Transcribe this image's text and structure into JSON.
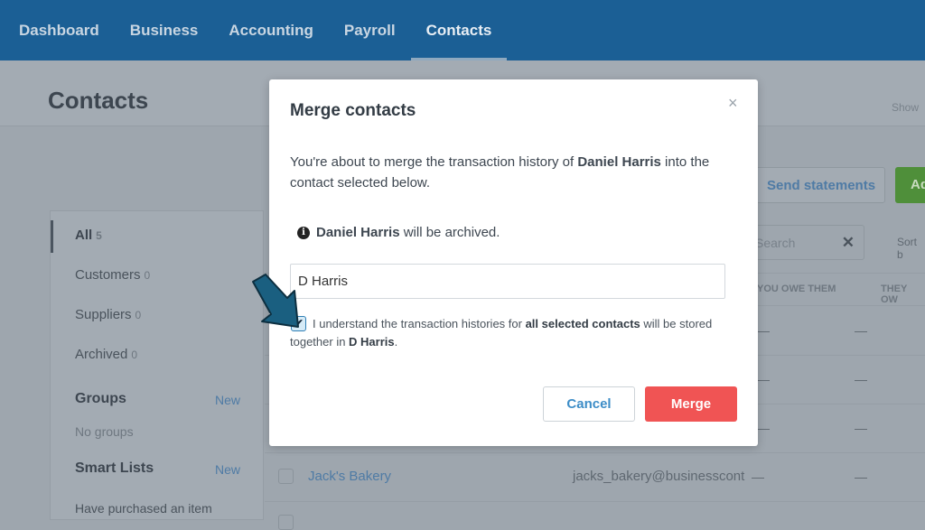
{
  "nav": {
    "items": [
      "Dashboard",
      "Business",
      "Accounting",
      "Payroll",
      "Contacts"
    ],
    "active": "Contacts"
  },
  "page": {
    "title": "Contacts",
    "show_link": "Show",
    "send_statements": "Send statements",
    "add_label": "Ad"
  },
  "sidebar": {
    "filters": [
      {
        "label": "All",
        "count": "5"
      },
      {
        "label": "Customers",
        "count": "0"
      },
      {
        "label": "Suppliers",
        "count": "0"
      },
      {
        "label": "Archived",
        "count": "0"
      }
    ],
    "groups_heading": "Groups",
    "groups_new": "New",
    "no_groups": "No groups",
    "smart_lists_heading": "Smart Lists",
    "smart_lists_new": "New",
    "smart_list_item": "Have purchased an item"
  },
  "table": {
    "search_placeholder": "Search",
    "sort_label": "Sort b",
    "headers": [
      "YOU OWE THEM",
      "THEY OW"
    ],
    "visible_row": {
      "name": "Jack's Bakery",
      "email": "jacks_bakery@businesscont",
      "you_owe": "—",
      "they_owe": "—"
    },
    "dash": "—"
  },
  "modal": {
    "title": "Merge contacts",
    "close_icon": "×",
    "desc_pre": "You're about to merge the transaction history of ",
    "desc_name": "Daniel Harris",
    "desc_post": " into the contact selected below.",
    "info_name": "Daniel Harris",
    "info_post": " will be archived.",
    "input_value": "D Harris",
    "checked": true,
    "ack_pre": "I understand the transaction histories for ",
    "ack_bold": "all selected contacts",
    "ack_mid": " will be stored together in ",
    "ack_name": "D Harris",
    "ack_end": ".",
    "cancel": "Cancel",
    "merge": "Merge"
  },
  "colors": {
    "nav": "#1b5f95",
    "merge": "#f05454",
    "link": "#3d8dc7",
    "arrow": "#1a5f80"
  }
}
